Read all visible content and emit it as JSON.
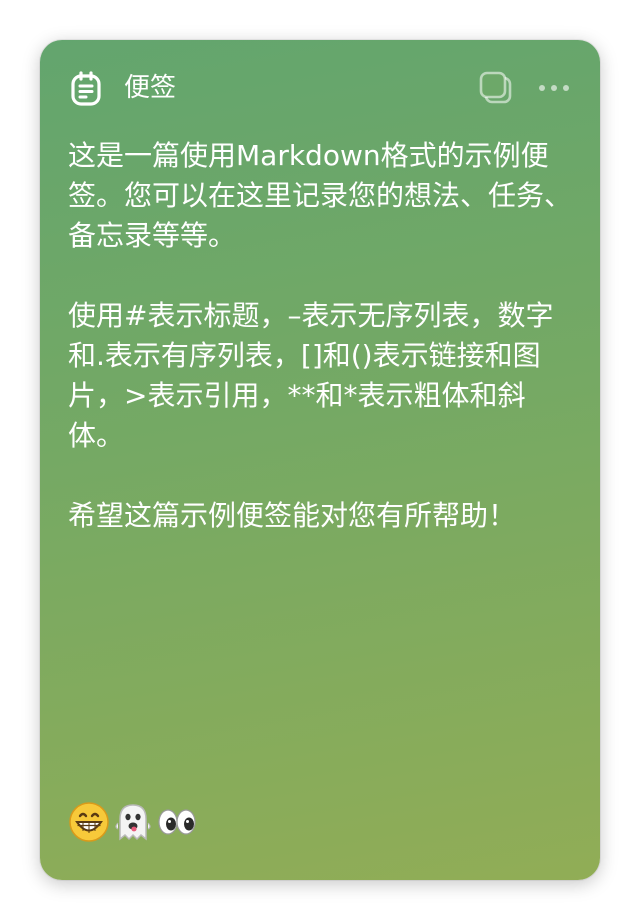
{
  "header": {
    "title": "便签",
    "app_icon": "note-icon",
    "stack_icon": "stack-icon",
    "more_icon": "more-horizontal-icon"
  },
  "note": {
    "paragraphs": [
      "这是一篇使用Markdown格式的示例便签。您可以在这里记录您的想法、任务、备忘录等等。",
      "使用#表示标题，–表示无序列表，数字和.表示有序列表，[]和()表示链接和图片，>表示引用，**和*表示粗体和斜体。",
      "希望这篇示例便签能对您有所帮助！"
    ],
    "emojis": [
      "grinning-face-emoji",
      "ghost-emoji",
      "eyes-emoji"
    ]
  },
  "colors": {
    "gradient_top": "#63a56e",
    "gradient_bottom": "#91ad56",
    "text": "#ffffff"
  }
}
